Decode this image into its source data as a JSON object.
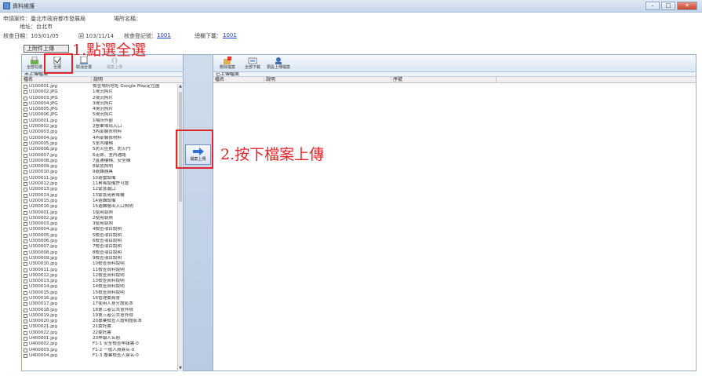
{
  "window": {
    "title": "資料維護"
  },
  "header": {
    "applicant_label": "申請案件：臺北市政府都市發展局",
    "site_name_label": "場所名稱：",
    "address_label": "地址：台北市",
    "check_date": "核查日期：103/01/05",
    "reply_date": "回 103/11/14",
    "check_register_label": "核查登記號：",
    "check_register_value": "1001",
    "download_label": "總欄下載：",
    "download_value": "1001"
  },
  "upload_attachment_button": "上附件上傳",
  "left_pane": {
    "toolbar": [
      {
        "label": "全部勾選",
        "icon": "select-all-icon"
      },
      {
        "label": "全選",
        "icon": "select-page-icon"
      },
      {
        "label": "取消全選",
        "icon": "unselect-icon"
      },
      {
        "label": "檔案上傳",
        "icon": "upload-icon"
      }
    ],
    "header": "未上傳檔案",
    "columns": [
      "檔名",
      "說明"
    ],
    "rows": [
      {
        "file": "U100001.jpg",
        "desc": "檢查場所地址 Google Map定位圖"
      },
      {
        "file": "U100002.JPG",
        "desc": "1現況照片"
      },
      {
        "file": "U100003.JPG",
        "desc": "2現況照片"
      },
      {
        "file": "U100004.JPG",
        "desc": "3現況照片"
      },
      {
        "file": "U100005.JPG",
        "desc": "4現況照片"
      },
      {
        "file": "U100006.JPG",
        "desc": "5現況照片"
      },
      {
        "file": "U200001.jpg",
        "desc": "1場所外觀"
      },
      {
        "file": "U200002.jpg",
        "desc": "2營業場出入口"
      },
      {
        "file": "U200003.jpg",
        "desc": "3內部裝修材料"
      },
      {
        "file": "U200004.jpg",
        "desc": "4內部裝修材料"
      },
      {
        "file": "U200005.jpg",
        "desc": "5室內樓梯"
      },
      {
        "file": "U200006.jpg",
        "desc": "5防火區劃、防火門"
      },
      {
        "file": "U200007.jpg",
        "desc": "6走廊、室內通路"
      },
      {
        "file": "U200008.jpg",
        "desc": "7直通樓梯、安全梯"
      },
      {
        "file": "U200009.jpg",
        "desc": "8緊急照明"
      },
      {
        "file": "U200010.jpg",
        "desc": "9避難器具"
      },
      {
        "file": "U200011.jpg",
        "desc": "10避雷設備"
      },
      {
        "file": "U200012.jpg",
        "desc": "11昇降設備許可證"
      },
      {
        "file": "U200013.jpg",
        "desc": "12緊急進口"
      },
      {
        "file": "U200014.jpg",
        "desc": "13緊急用昇降機"
      },
      {
        "file": "U200015.jpg",
        "desc": "14避難設備"
      },
      {
        "file": "U200016.jpg",
        "desc": "15避難層出入口照明"
      },
      {
        "file": "U300001.jpg",
        "desc": "1使用執照"
      },
      {
        "file": "U300002.jpg",
        "desc": "2使用執照"
      },
      {
        "file": "U300003.jpg",
        "desc": "3使用執照"
      },
      {
        "file": "U300004.jpg",
        "desc": "4檢查項目說明"
      },
      {
        "file": "U300005.jpg",
        "desc": "5檢查項目說明"
      },
      {
        "file": "U300006.jpg",
        "desc": "6檢查項目說明"
      },
      {
        "file": "U300007.jpg",
        "desc": "7檢查項目說明"
      },
      {
        "file": "U300008.jpg",
        "desc": "8檢查項目說明"
      },
      {
        "file": "U300009.jpg",
        "desc": "9檢查項目說明"
      },
      {
        "file": "U300010.jpg",
        "desc": "10檢查資料說明"
      },
      {
        "file": "U300011.jpg",
        "desc": "11檢查資料說明"
      },
      {
        "file": "U300012.jpg",
        "desc": "12檢查資料說明"
      },
      {
        "file": "U300013.jpg",
        "desc": "13檢查資料說明"
      },
      {
        "file": "U300014.jpg",
        "desc": "14檢查資料說明"
      },
      {
        "file": "U300015.jpg",
        "desc": "15檢查資料說明"
      },
      {
        "file": "U300016.jpg",
        "desc": "16管理委員會"
      },
      {
        "file": "U300017.jpg",
        "desc": "17使用人身分證影本"
      },
      {
        "file": "U300018.jpg",
        "desc": "18第三者公共意外險"
      },
      {
        "file": "U300019.jpg",
        "desc": "19第三者公共意外險"
      },
      {
        "file": "U300020.jpg",
        "desc": "20專業檢查人證明證影本"
      },
      {
        "file": "U300021.jpg",
        "desc": "21委託書"
      },
      {
        "file": "U300022.jpg",
        "desc": "22委託書"
      },
      {
        "file": "U400001.jpg",
        "desc": "23申報人名冊"
      },
      {
        "file": "U400002.jpg",
        "desc": "F1-1 安全檢查申報書-0"
      },
      {
        "file": "U400003.jpg",
        "desc": "F1-2 一般人員簽名-0"
      },
      {
        "file": "U400004.jpg",
        "desc": "F1-3 專業檢查人簽名-0"
      }
    ]
  },
  "middle": {
    "upload_label": "檔案上傳"
  },
  "right_pane": {
    "toolbar": [
      {
        "label": "刪除檔案",
        "icon": "delete-icon"
      },
      {
        "label": "全部下載",
        "icon": "download-icon"
      },
      {
        "label": "預設上傳檔案",
        "icon": "preset-icon"
      }
    ],
    "header": "已上傳檔案",
    "columns": [
      "檔名",
      "說明",
      "序號"
    ]
  },
  "annotations": {
    "step1": "1.點選全選",
    "step2": "2.按下檔案上傳"
  },
  "colors": {
    "highlight": "#e0262c",
    "accent": "#98afcf"
  }
}
